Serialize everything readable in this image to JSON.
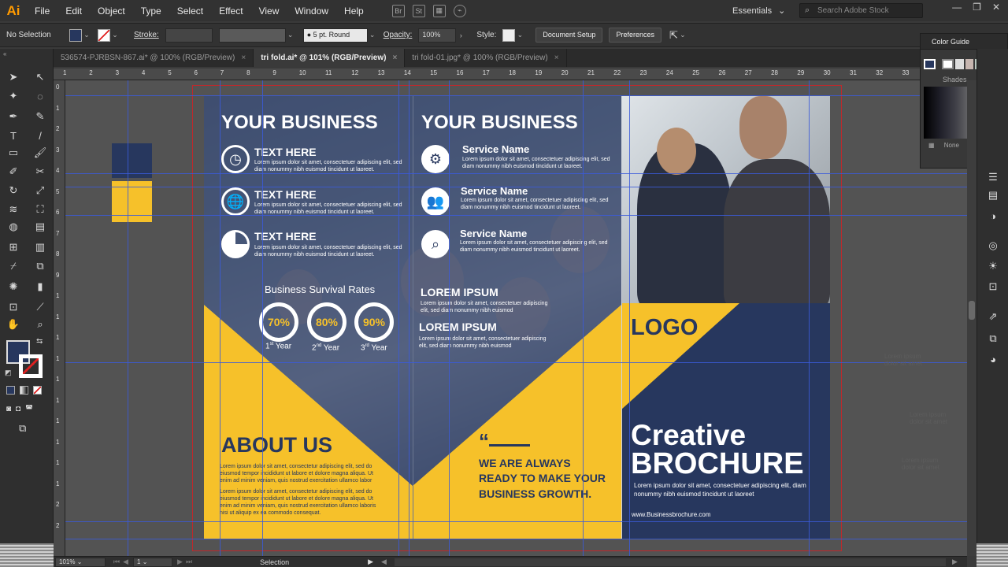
{
  "app": {
    "logo": "Ai",
    "menu": [
      "File",
      "Edit",
      "Object",
      "Type",
      "Select",
      "Effect",
      "View",
      "Window",
      "Help"
    ],
    "workspace": "Essentials",
    "stock_search_placeholder": "Search Adobe Stock",
    "bridge_label": "Br",
    "stock_label": "St"
  },
  "control_bar": {
    "selection": "No Selection",
    "stroke_label": "Stroke:",
    "brush": "5 pt. Round",
    "opacity_label": "Opacity:",
    "opacity": "100%",
    "style_label": "Style:",
    "doc_setup": "Document Setup",
    "preferences": "Preferences"
  },
  "tabs": [
    {
      "label": "536574-PJRBSN-867.ai* @ 100% (RGB/Preview)",
      "close": "×"
    },
    {
      "label": "tri fold.ai* @ 101% (RGB/Preview)",
      "close": "×"
    },
    {
      "label": "tri fold-01.jpg* @ 100% (RGB/Preview)",
      "close": "×"
    }
  ],
  "ruler_top": [
    "1",
    "2",
    "3",
    "4",
    "5",
    "6",
    "7",
    "8",
    "9",
    "10",
    "11",
    "12",
    "13",
    "14",
    "15",
    "16",
    "17",
    "18",
    "19",
    "20",
    "21",
    "22",
    "23",
    "24",
    "25",
    "26",
    "27",
    "28",
    "29",
    "30",
    "31",
    "32",
    "33"
  ],
  "ruler_left": [
    "0",
    "1",
    "2",
    "3",
    "4",
    "5",
    "6",
    "7",
    "8",
    "9",
    "1",
    "1",
    "1",
    "1",
    "1",
    "1",
    "1",
    "1",
    "1",
    "1",
    "2",
    "2"
  ],
  "color_guide": {
    "title": "Color Guide",
    "shades": "Shades",
    "none": "None"
  },
  "brochure": {
    "panel1": {
      "title": "YOUR BUSINESS",
      "items": [
        {
          "title": "TEXT HERE",
          "icon": "clock-icon",
          "body": "Lorem ipsum dolor sit amet, consectetuer adipiscing elit, sed diam nonummy nibh euismod tincidunt ut laoreet."
        },
        {
          "title": "TEXT HERE",
          "icon": "globe-icon",
          "body": "Lorem ipsum dolor sit amet, consectetuer adipiscing elit, sed diam nonummy nibh euismod tincidunt ut laoreet."
        },
        {
          "title": "TEXT HERE",
          "icon": "pie-chart-icon",
          "body": "Lorem ipsum dolor sit amet, consectetuer adipiscing elit, sed diam nonummy nibh euismod tincidunt ut laoreet."
        }
      ],
      "survival_title": "Business Survival Rates",
      "rates": [
        {
          "value": "70%",
          "label_num": "1",
          "label_sup": "st",
          "label_rest": " Year"
        },
        {
          "value": "80%",
          "label_num": "2",
          "label_sup": "nd",
          "label_rest": " Year"
        },
        {
          "value": "90%",
          "label_num": "3",
          "label_sup": "rd",
          "label_rest": " Year"
        }
      ],
      "about_title": "ABOUT US",
      "about_p1": "Lorem ipsum dolor sit amet, consectetur adipiscing elit, sed do eiusmod tempor incididunt ut labore et dolore magna aliqua. Ut enim ad minim veniam, quis nostrud exercitation ullamco labor",
      "about_p2": "Lorem ipsum dolor sit amet, consectetur adipiscing elit, sed do eiusmod tempor incididunt ut labore et dolore magna aliqua. Ut enim ad minim veniam, quis nostrud exercitation ullamco laboris nisi ut aliquip ex ea commodo consequat."
    },
    "panel2": {
      "title": "YOUR BUSINESS",
      "services": [
        {
          "title": "Service Name",
          "icon": "gear-icon",
          "body": "Lorem ipsum dolor sit amet, consectetuer adipiscing elit, sed diam nonummy nibh euismod tincidunt ut laoreet."
        },
        {
          "title": "Service Name",
          "icon": "team-icon",
          "body": "Lorem ipsum dolor sit amet, consectetuer adipiscing elit, sed diam nonummy nibh euismod tincidunt ut laoreet."
        },
        {
          "title": "Service Name",
          "icon": "search-icon",
          "body": "Lorem ipsum dolor sit amet, consectetuer adipiscing elit, sed diam nonummy nibh euismod tincidunt ut laoreet."
        }
      ],
      "lorem1_title": "LOREM IPSUM",
      "lorem1_body": "Lorem ipsum dolor sit amet, consectetuer adipiscing elit, sed diam nonummy nibh euismod",
      "lorem2_title": "LOREM IPSUM",
      "lorem2_body": "Lorem ipsum dolor sit amet, consectetuer adipiscing elit, sed diam nonummy nibh euismod",
      "quote_mark": "“",
      "quote": [
        "WE ARE ALWAYS",
        "READY TO MAKE YOUR",
        "BUSINESS GROWTH."
      ]
    },
    "panel3": {
      "logo": "LOGO",
      "creative": "Creative",
      "brochure": "BROCHURE",
      "body": "Lorem ipsum dolor sit amet, consectetuer adipiscing elit, diam nonummy nibh euismod tincidunt ut laoreet",
      "url": "www.Businessbrochure.com"
    },
    "colors": {
      "navy": "#27375e",
      "yellow": "#f6c12a"
    }
  },
  "pasteboard_notes": [
    "Lorem ipsum dolor sit amet",
    "Lorem ipsum dolor sit amet",
    "Lorem ipsum dolor sit amet"
  ],
  "status": {
    "zoom": "101%",
    "artboard": "1",
    "tool": "Selection"
  }
}
